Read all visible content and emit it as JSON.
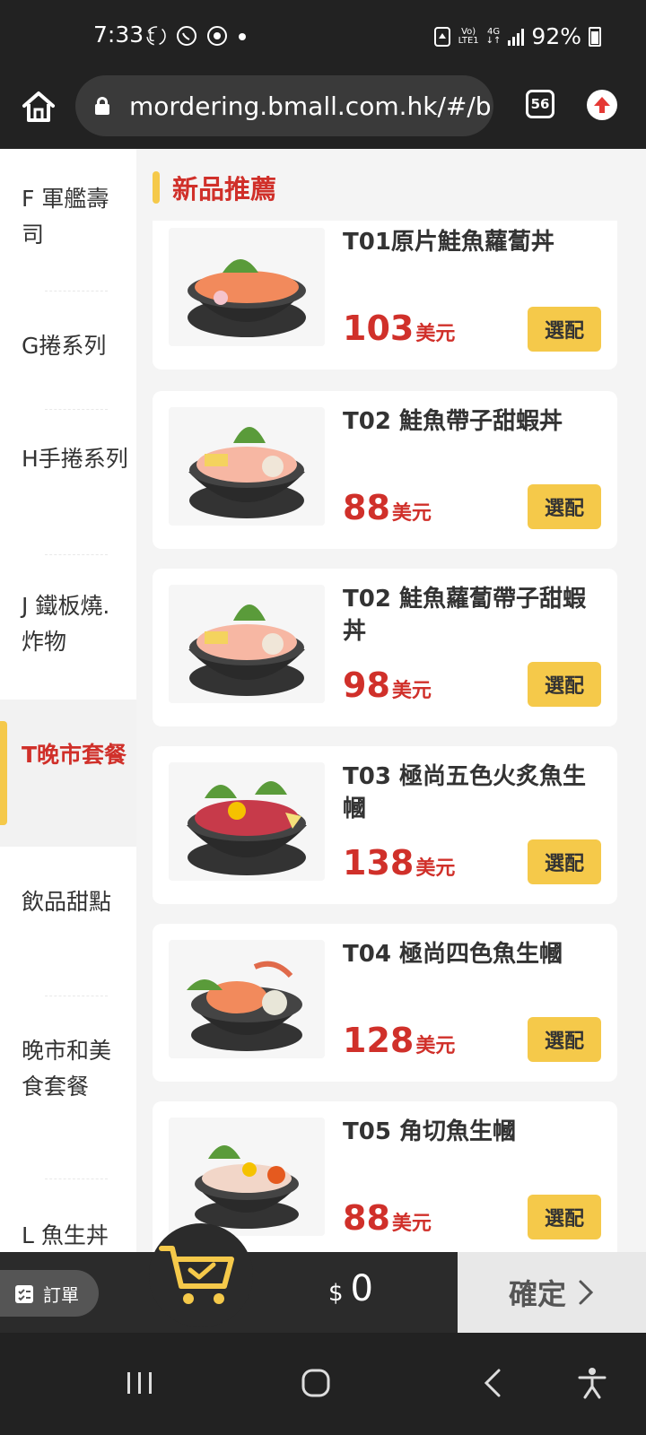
{
  "status": {
    "time": "7:33",
    "network_top": "Vo)",
    "network_bottom": "LTE1",
    "data_type": "4G",
    "battery": "92%"
  },
  "browser": {
    "url": "mordering.bmall.com.hk/#/b",
    "tab_count": "56"
  },
  "sidebar": {
    "items": [
      {
        "label": "F 軍艦壽司"
      },
      {
        "label": "G捲系列"
      },
      {
        "label": "H手捲系列"
      },
      {
        "label": "J 鐵板燒.炸物"
      },
      {
        "label": "T晚市套餐"
      },
      {
        "label": "飲品甜點"
      },
      {
        "label": "晚市和美食套餐"
      },
      {
        "label": "L 魚生丼"
      }
    ]
  },
  "section": {
    "title": "新品推薦"
  },
  "products": [
    {
      "name": "T01原片鮭魚蘿蔔丼",
      "price": "103",
      "currency": "美元",
      "button": "選配"
    },
    {
      "name": "T02 鮭魚帶子甜蝦丼",
      "price": "88",
      "currency": "美元",
      "button": "選配"
    },
    {
      "name": "T02 鮭魚蘿蔔帶子甜蝦丼",
      "price": "98",
      "currency": "美元",
      "button": "選配"
    },
    {
      "name": "T03 極尚五色火炙魚生幗",
      "price": "138",
      "currency": "美元",
      "button": "選配"
    },
    {
      "name": "T04 極尚四色魚生幗",
      "price": "128",
      "currency": "美元",
      "button": "選配"
    },
    {
      "name": "T05 角切魚生幗",
      "price": "88",
      "currency": "美元",
      "button": "選配"
    }
  ],
  "order_bar": {
    "order_label": "訂單",
    "currency_symbol": "$",
    "total": "0",
    "confirm_label": "確定"
  },
  "colors": {
    "accent_red": "#d0302a",
    "accent_yellow": "#f5c94a"
  }
}
